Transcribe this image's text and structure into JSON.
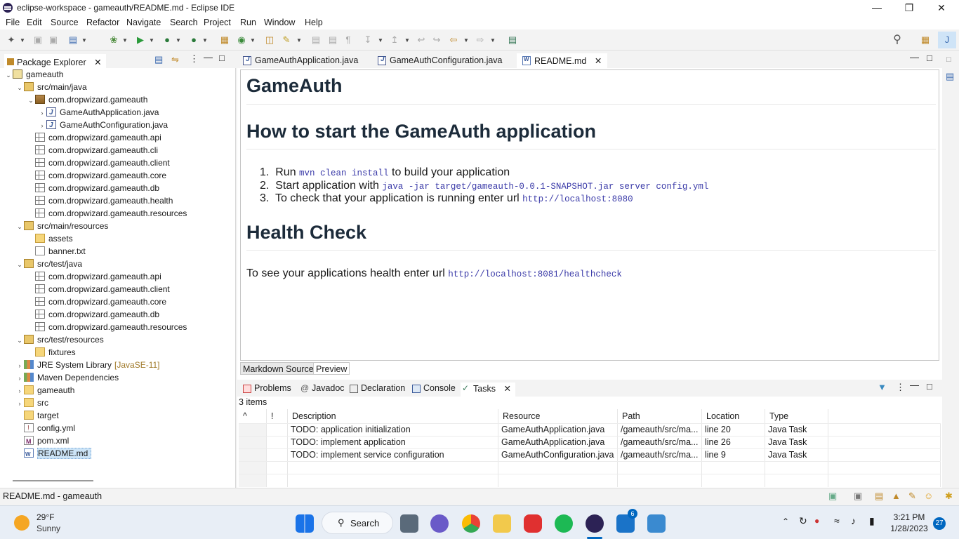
{
  "window": {
    "title": "eclipse-workspace - gameauth/README.md - Eclipse IDE"
  },
  "menu": [
    "File",
    "Edit",
    "Source",
    "Refactor",
    "Navigate",
    "Search",
    "Project",
    "Run",
    "Window",
    "Help"
  ],
  "package_explorer": {
    "tab_label": "Package Explorer",
    "tree": [
      {
        "label": "gameauth",
        "icon": "project-icon"
      },
      {
        "label": "src/main/java",
        "icon": "source-folder-icon"
      },
      {
        "label": "com.dropwizard.gameauth",
        "icon": "package-icon"
      },
      {
        "label": "GameAuthApplication.java",
        "icon": "java-file-icon"
      },
      {
        "label": "GameAuthConfiguration.java",
        "icon": "java-file-icon"
      },
      {
        "label": "com.dropwizard.gameauth.api",
        "icon": "empty-package-icon"
      },
      {
        "label": "com.dropwizard.gameauth.cli",
        "icon": "empty-package-icon"
      },
      {
        "label": "com.dropwizard.gameauth.client",
        "icon": "empty-package-icon"
      },
      {
        "label": "com.dropwizard.gameauth.core",
        "icon": "empty-package-icon"
      },
      {
        "label": "com.dropwizard.gameauth.db",
        "icon": "empty-package-icon"
      },
      {
        "label": "com.dropwizard.gameauth.health",
        "icon": "empty-package-icon"
      },
      {
        "label": "com.dropwizard.gameauth.resources",
        "icon": "empty-package-icon"
      },
      {
        "label": "src/main/resources",
        "icon": "source-folder-icon"
      },
      {
        "label": "assets",
        "icon": "folder-icon"
      },
      {
        "label": "banner.txt",
        "icon": "text-file-icon"
      },
      {
        "label": "src/test/java",
        "icon": "source-folder-icon"
      },
      {
        "label": "com.dropwizard.gameauth.api",
        "icon": "empty-package-icon"
      },
      {
        "label": "com.dropwizard.gameauth.client",
        "icon": "empty-package-icon"
      },
      {
        "label": "com.dropwizard.gameauth.core",
        "icon": "empty-package-icon"
      },
      {
        "label": "com.dropwizard.gameauth.db",
        "icon": "empty-package-icon"
      },
      {
        "label": "com.dropwizard.gameauth.resources",
        "icon": "empty-package-icon"
      },
      {
        "label": "src/test/resources",
        "icon": "source-folder-icon"
      },
      {
        "label": "fixtures",
        "icon": "folder-icon"
      },
      {
        "label": "JRE System Library",
        "suffix": "[JavaSE-11]",
        "icon": "library-icon"
      },
      {
        "label": "Maven Dependencies",
        "icon": "library-icon"
      },
      {
        "label": "gameauth",
        "icon": "folder-icon"
      },
      {
        "label": "src",
        "icon": "folder-icon"
      },
      {
        "label": "target",
        "icon": "folder-icon"
      },
      {
        "label": "config.yml",
        "icon": "yml-file-icon"
      },
      {
        "label": "pom.xml",
        "icon": "maven-file-icon"
      },
      {
        "label": "README.md",
        "icon": "markdown-file-icon"
      }
    ]
  },
  "editor": {
    "tabs": [
      "GameAuthApplication.java",
      "GameAuthConfiguration.java",
      "README.md"
    ],
    "bottom_tabs": [
      "Markdown Source",
      "Preview"
    ],
    "content": {
      "h1": "GameAuth",
      "h2": "How to start the GameAuth application",
      "steps": [
        {
          "num": "1.",
          "pre": "Run ",
          "code": "mvn clean install",
          "post": " to build your application"
        },
        {
          "num": "2.",
          "pre": "Start application with ",
          "code": "java -jar target/gameauth-0.0.1-SNAPSHOT.jar server config.yml",
          "post": ""
        },
        {
          "num": "3.",
          "pre": "To check that your application is running enter url ",
          "code": "http://localhost:8080",
          "post": ""
        }
      ],
      "h3": "Health Check",
      "health_pre": "To see your applications health enter url ",
      "health_code": "http://localhost:8081/healthcheck"
    }
  },
  "bottom_panel": {
    "tabs": [
      "Problems",
      "Javadoc",
      "Declaration",
      "Console",
      "Tasks"
    ],
    "item_count": "3 items",
    "columns": [
      "!",
      "Description",
      "Resource",
      "Path",
      "Location",
      "Type"
    ],
    "rows": [
      [
        "",
        "TODO: application initialization",
        "GameAuthApplication.java",
        "/gameauth/src/ma...",
        "line 20",
        "Java Task"
      ],
      [
        "",
        "TODO: implement application",
        "GameAuthApplication.java",
        "/gameauth/src/ma...",
        "line 26",
        "Java Task"
      ],
      [
        "",
        "TODO: implement service configuration",
        "GameAuthConfiguration.java",
        "/gameauth/src/ma...",
        "line 9",
        "Java Task"
      ]
    ]
  },
  "status_bar": {
    "text": "README.md - gameauth"
  },
  "taskbar": {
    "weather_temp": "29°F",
    "weather_desc": "Sunny",
    "search_label": "Search",
    "time": "3:21 PM",
    "date": "1/28/2023",
    "notification_count": "27",
    "mail_badge": "6",
    "colors": {
      "accent": "#0067c0",
      "weather_sun": "#f5a623"
    }
  }
}
